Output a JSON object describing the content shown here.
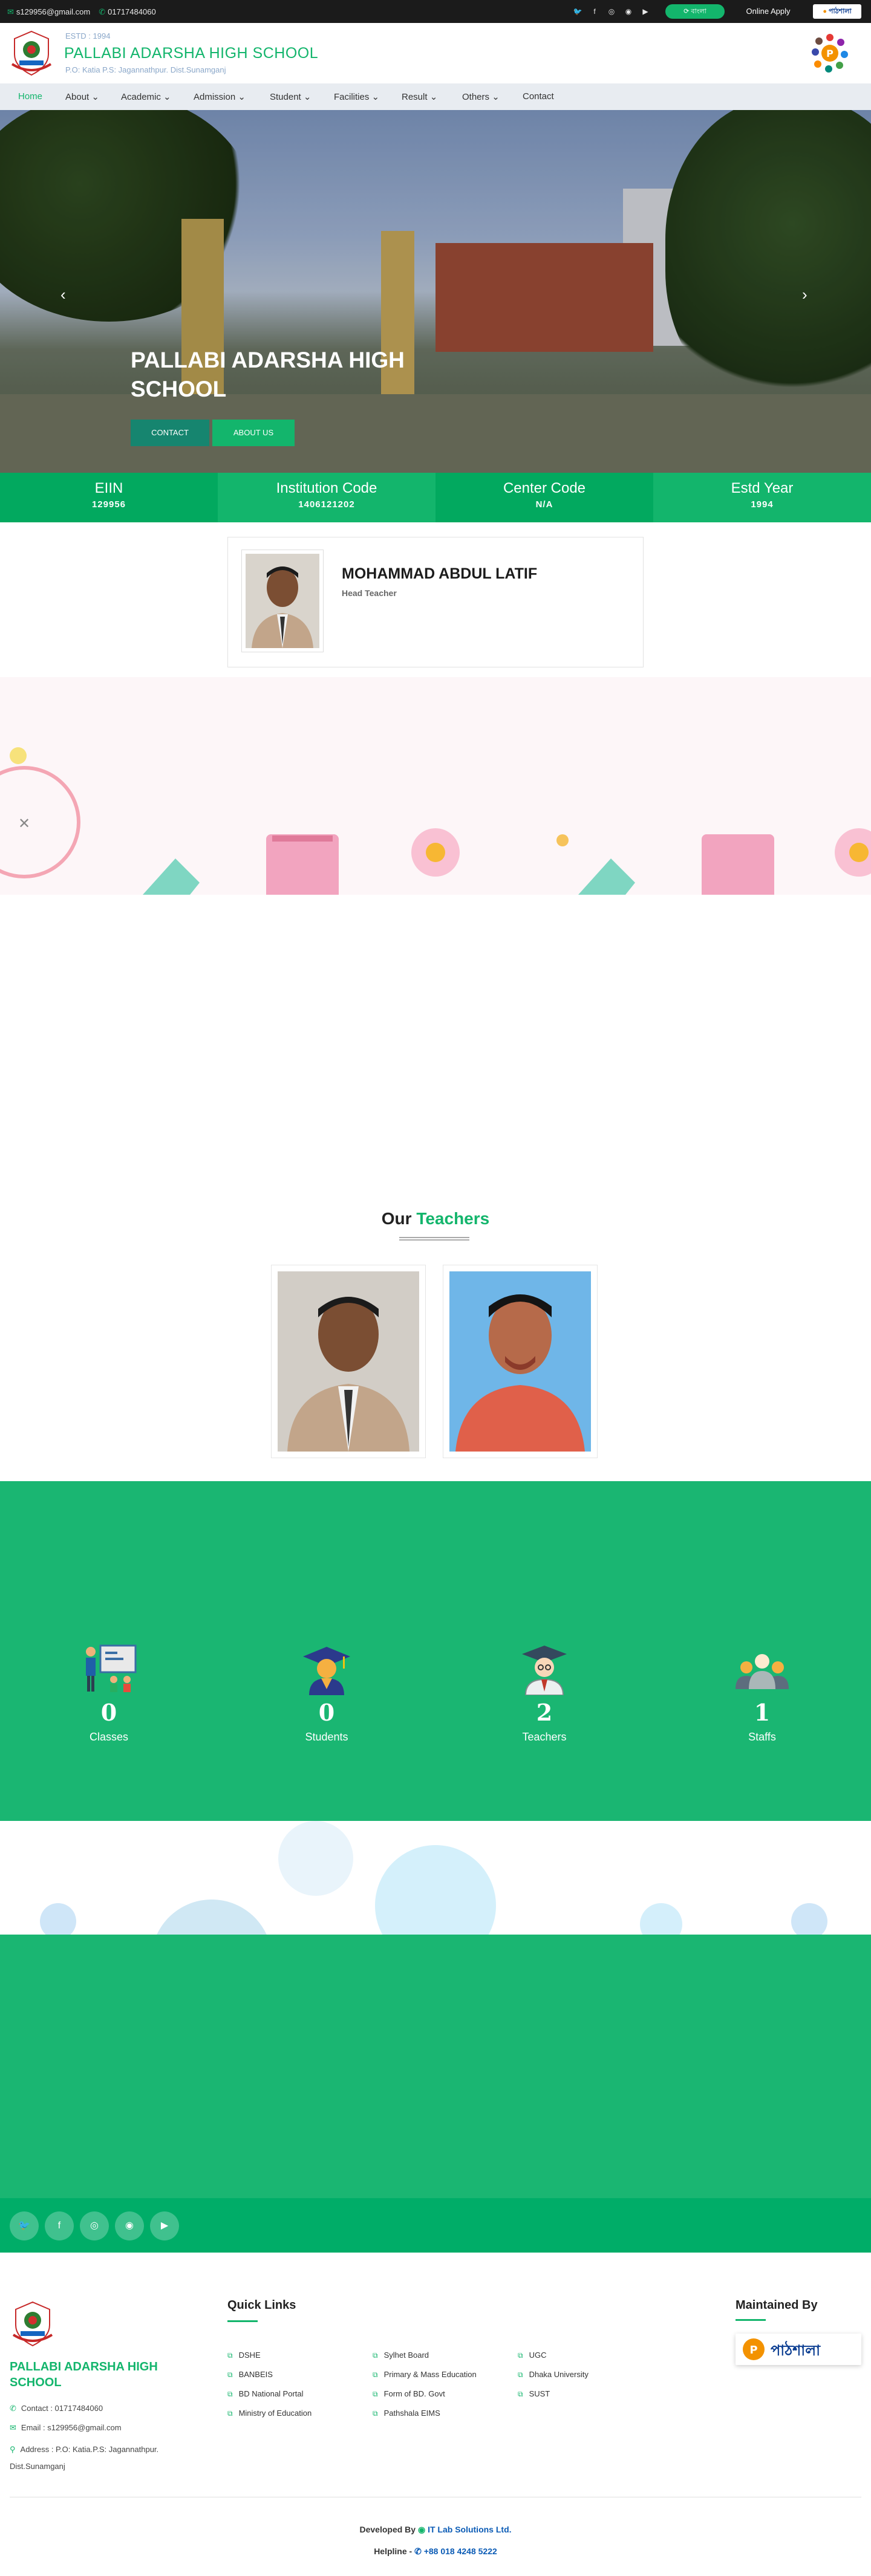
{
  "topbar": {
    "email": "s129956@gmail.com",
    "phone": "01717484060",
    "social_icons": [
      "twitter-icon",
      "facebook-icon",
      "instagram-icon",
      "whatsapp-icon",
      "youtube-icon"
    ],
    "lang_button": "বাংলা",
    "apply_button": "Online Apply",
    "partner_badge": "পাঠশালা"
  },
  "header": {
    "estd": "ESTD : 1994",
    "school_name": "PALLABI ADARSHA HIGH SCHOOL",
    "address": "P.O: Katia P.S: Jagannathpur. Dist.Sunamganj"
  },
  "nav": {
    "items": [
      "Home",
      "About",
      "Academic",
      "Admission",
      "Student",
      "Facilities",
      "Result",
      "Others",
      "Contact"
    ],
    "active": "Home"
  },
  "hero": {
    "title": "PALLABI ADARSHA HIGH SCHOOL",
    "contact_button": "CONTACT",
    "about_button": "ABOUT US"
  },
  "stats": [
    {
      "label": "EIIN",
      "value": "129956",
      "color": "#02a95f"
    },
    {
      "label": "Institution Code",
      "value": "1406121202",
      "color": "#13b56c"
    },
    {
      "label": "Center Code",
      "value": "N/A",
      "color": "#02a95f"
    },
    {
      "label": "Estd Year",
      "value": "1994",
      "color": "#13b56c"
    }
  ],
  "head_teacher": {
    "name": "MOHAMMAD ABDUL LATIF",
    "role": "Head Teacher"
  },
  "teachers": {
    "title_main": "Our",
    "title_accent": "Teachers"
  },
  "counters": [
    {
      "value": "0",
      "label": "Classes",
      "icon": "classroom-icon"
    },
    {
      "value": "0",
      "label": "Students",
      "icon": "graduate-icon"
    },
    {
      "value": "2",
      "label": "Teachers",
      "icon": "teacher-icon"
    },
    {
      "value": "1",
      "label": "Staffs",
      "icon": "staff-group-icon"
    }
  ],
  "footer": {
    "school_name": "PALLABI ADARSHA HIGH SCHOOL",
    "contact": "Contact : 01717484060",
    "email": "Email : s129956@gmail.com",
    "address": "Address : P.O: Katia.P.S: Jagannathpur. Dist.Sunamganj",
    "quick_links_title": "Quick Links",
    "quick_links": [
      [
        "DSHE",
        "BANBEIS",
        "BD National Portal",
        "Ministry of Education"
      ],
      [
        "Sylhet Board",
        "Primary & Mass Education",
        "Form of BD. Govt",
        "Pathshala EIMS"
      ],
      [
        "UGC",
        "Dhaka University",
        "SUST"
      ]
    ],
    "maintained_title": "Maintained By",
    "maintained_logo_text": "পাঠশালা",
    "developed_by": "Developed By",
    "developer": "IT Lab Solutions Ltd.",
    "helpline_label": "Helpline -",
    "helpline_number": "+88 018 4248 5222"
  }
}
